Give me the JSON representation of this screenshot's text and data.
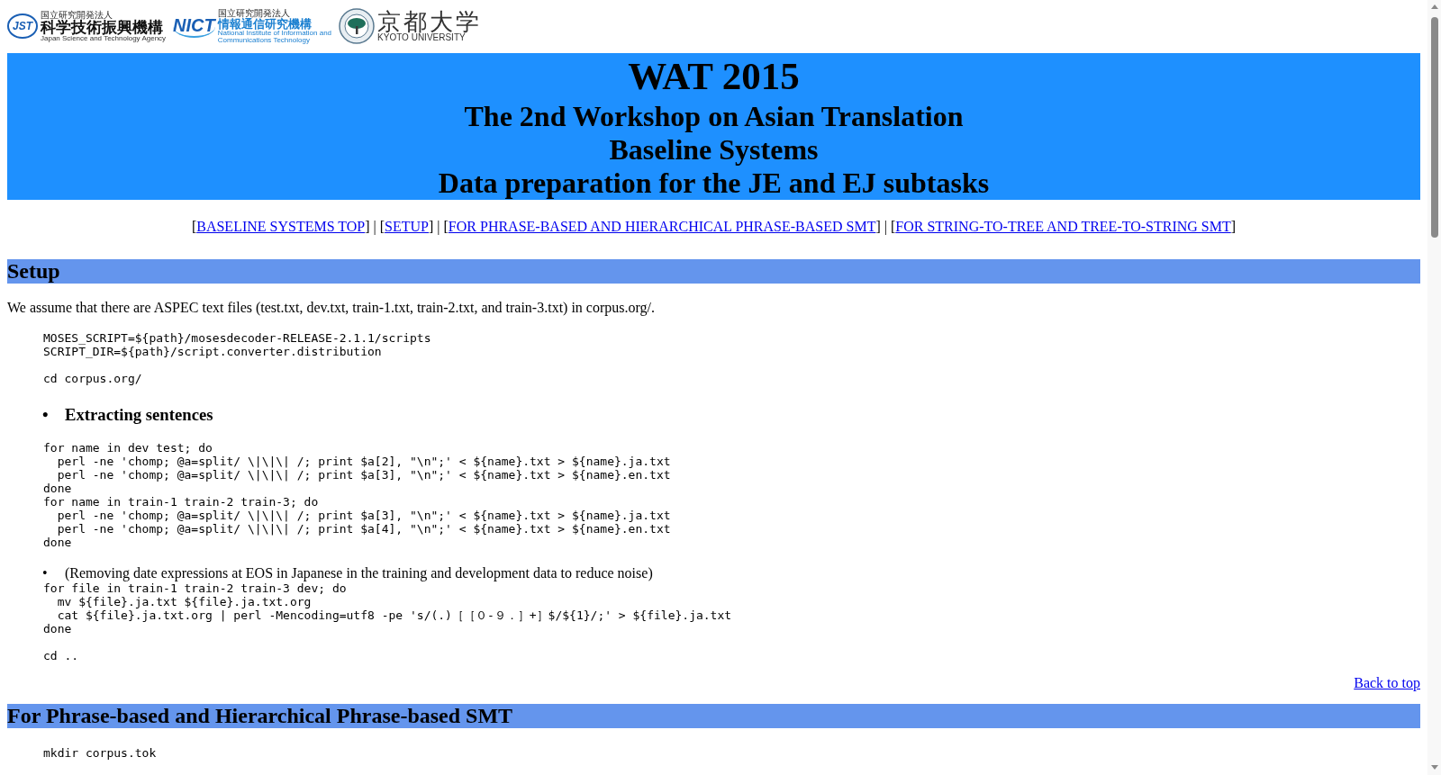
{
  "logos": [
    {
      "kind": "jst",
      "mark": "JST",
      "small": "国立研究開発法人",
      "name": "科学技術振興機構",
      "english": [
        "Japan Science and Technology Agency"
      ]
    },
    {
      "kind": "nict",
      "mark": "NICT",
      "small": "国立研究開発法人",
      "name": "情報通信研究機構",
      "english": [
        "National Institute of Information and",
        "Communications Technology"
      ]
    },
    {
      "kind": "kyoto",
      "name": "京都大学",
      "english": [
        "KYOTO UNIVERSITY"
      ]
    }
  ],
  "header": {
    "title": "WAT 2015",
    "lines": [
      "The 2nd Workshop on Asian Translation",
      "Baseline Systems",
      "Data preparation for the JE and EJ subtasks"
    ]
  },
  "nav": [
    {
      "kind": "bracket",
      "text": "["
    },
    {
      "kind": "link",
      "text": "BASELINE SYSTEMS TOP"
    },
    {
      "kind": "bracket",
      "text": "]"
    },
    {
      "kind": "separator",
      "text": "|"
    },
    {
      "kind": "bracket",
      "text": "["
    },
    {
      "kind": "link",
      "text": "SETUP"
    },
    {
      "kind": "bracket",
      "text": "]"
    },
    {
      "kind": "separator",
      "text": "|"
    },
    {
      "kind": "bracket",
      "text": "["
    },
    {
      "kind": "link",
      "text": "FOR PHRASE-BASED AND HIERARCHICAL PHRASE-BASED SMT"
    },
    {
      "kind": "bracket",
      "text": "]"
    },
    {
      "kind": "separator",
      "text": "|"
    },
    {
      "kind": "bracket",
      "text": "["
    },
    {
      "kind": "link",
      "text": "FOR STRING-TO-TREE AND TREE-TO-STRING SMT"
    },
    {
      "kind": "bracket",
      "text": "]"
    }
  ],
  "sections": [
    {
      "heading": "Setup",
      "content": [
        {
          "kind": "paragraph",
          "text": "We assume that there are ASPEC text files (test.txt, dev.txt, train-1.txt, train-2.txt, and train-3.txt) in corpus.org/."
        },
        {
          "kind": "code",
          "groups": [
            [
              "MOSES_SCRIPT=${path}/mosesdecoder-RELEASE-2.1.1/scripts",
              "SCRIPT_DIR=${path}/script.converter.distribution"
            ],
            [
              "cd corpus.org/"
            ]
          ]
        },
        {
          "kind": "subheading",
          "bullet": "•",
          "text": "Extracting sentences"
        },
        {
          "kind": "code",
          "groups": [
            [
              "for name in dev test; do",
              "  perl -ne 'chomp; @a=split/ \\|\\|\\| /; print $a[2], \"\\n\";' < ${name}.txt > ${name}.ja.txt",
              "  perl -ne 'chomp; @a=split/ \\|\\|\\| /; print $a[3], \"\\n\";' < ${name}.txt > ${name}.en.txt",
              "done",
              "for name in train-1 train-2 train-3; do",
              "  perl -ne 'chomp; @a=split/ \\|\\|\\| /; print $a[3], \"\\n\";' < ${name}.txt > ${name}.ja.txt",
              "  perl -ne 'chomp; @a=split/ \\|\\|\\| /; print $a[4], \"\\n\";' < ${name}.txt > ${name}.en.txt",
              "done"
            ]
          ]
        },
        {
          "kind": "bullet",
          "bullet": "•",
          "text": "(Removing date expressions at EOS in Japanese in the training and development data to reduce noise)"
        },
        {
          "kind": "code",
          "groups": [
            [
              "for file in train-1 train-2 train-3 dev; do",
              "  mv ${file}.ja.txt ${file}.ja.txt.org",
              "  cat ${file}.ja.txt.org | perl -Mencoding=utf8 -pe 's/(.)［［０-９．］+］$/${1}/;' > ${file}.ja.txt",
              "done"
            ],
            [
              "cd .."
            ]
          ]
        }
      ],
      "back_link": "Back to top"
    },
    {
      "heading": "For Phrase-based and Hierarchical Phrase-based SMT",
      "content": [
        {
          "kind": "code",
          "groups": [
            [
              "mkdir corpus.tok"
            ]
          ]
        }
      ]
    }
  ]
}
